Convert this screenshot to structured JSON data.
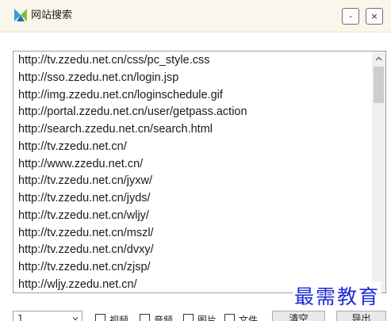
{
  "window": {
    "title": "网站搜索",
    "minimize_label": "-",
    "close_label": "×"
  },
  "results": [
    "http://tv.zzedu.net.cn/css/pc_style.css",
    "http://sso.zzedu.net.cn/login.jsp",
    "http://img.zzedu.net.cn/loginschedule.gif",
    "http://portal.zzedu.net.cn/user/getpass.action",
    "http://search.zzedu.net.cn/search.html",
    "http://tv.zzedu.net.cn/",
    "http://www.zzedu.net.cn/",
    "http://tv.zzedu.net.cn/jyxw/",
    "http://tv.zzedu.net.cn/jyds/",
    "http://tv.zzedu.net.cn/wljy/",
    "http://tv.zzedu.net.cn/mszl/",
    "http://tv.zzedu.net.cn/dvxy/",
    "http://tv.zzedu.net.cn/zjsp/",
    "http://wljy.zzedu.net.cn/"
  ],
  "bottom": {
    "select_value": "1",
    "filters": [
      "视频",
      "音频",
      "图片",
      "文件"
    ],
    "clear_label": "清空",
    "export_label": "导出"
  },
  "watermark": "最需教育",
  "colors": {
    "titlebar_bg": "#fbf6ec",
    "watermark": "#1d2bd4"
  },
  "icons": {
    "app": "app-logo-icon",
    "scroll_up": "chevron-up-icon",
    "dropdown": "chevron-down-icon"
  }
}
